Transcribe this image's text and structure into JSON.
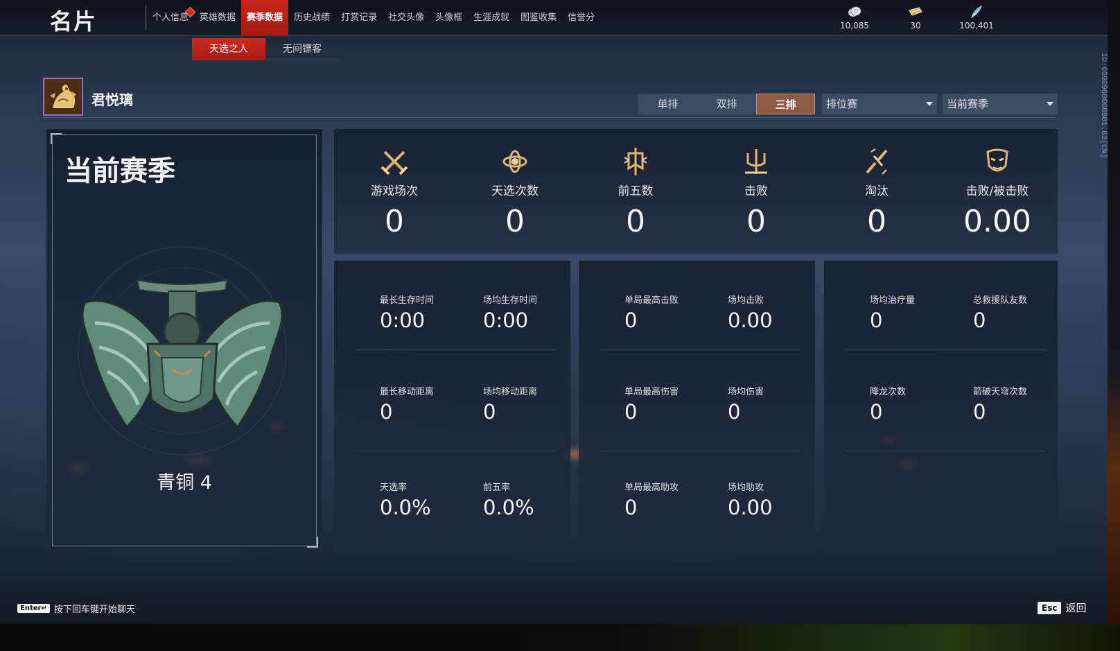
{
  "app_title": "名片",
  "main_tabs": [
    {
      "label": "个人信息",
      "badge": true
    },
    {
      "label": "英雄数据"
    },
    {
      "label": "赛季数据",
      "active": true
    },
    {
      "label": "历史战绩"
    },
    {
      "label": "打赏记录"
    },
    {
      "label": "社交头像"
    },
    {
      "label": "头像框"
    },
    {
      "label": "生涯成就"
    },
    {
      "label": "图鉴收集"
    },
    {
      "label": "信誉分"
    }
  ],
  "currency": [
    {
      "icon": "silver-coin-icon",
      "value": "10,085"
    },
    {
      "icon": "ticket-icon",
      "value": "30"
    },
    {
      "icon": "feather-icon",
      "value": "100,401"
    }
  ],
  "sub_tabs": [
    {
      "label": "天选之人",
      "active": true
    },
    {
      "label": "无间镖客"
    }
  ],
  "player": {
    "name": "君悦璃",
    "id": "ID:6690960000801.63[CN]"
  },
  "filters": {
    "modes": [
      {
        "label": "单排"
      },
      {
        "label": "双排"
      },
      {
        "label": "三排",
        "active": true
      }
    ],
    "match_type": "排位赛",
    "season": "当前赛季"
  },
  "season_panel": {
    "title": "当前赛季",
    "rank": "青铜 4"
  },
  "top_stats": [
    {
      "icon": "crossed-swords-icon",
      "label": "游戏场次",
      "value": "0"
    },
    {
      "icon": "lotus-icon",
      "label": "天选次数",
      "value": "0"
    },
    {
      "icon": "banner-icon",
      "label": "前五数",
      "value": "0"
    },
    {
      "icon": "trident-icon",
      "label": "击败",
      "value": "0"
    },
    {
      "icon": "broken-blade-icon",
      "label": "淘汰",
      "value": "0"
    },
    {
      "icon": "mask-icon",
      "label": "击败/被击败",
      "value": "0.00"
    }
  ],
  "detail_panels": [
    {
      "rows": [
        [
          {
            "label": "最长生存时间",
            "value": "0:00"
          },
          {
            "label": "场均生存时间",
            "value": "0:00"
          }
        ],
        [
          {
            "label": "最长移动距离",
            "value": "0"
          },
          {
            "label": "场均移动距离",
            "value": "0"
          }
        ],
        [
          {
            "label": "天选率",
            "value": "0.0%"
          },
          {
            "label": "前五率",
            "value": "0.0%"
          }
        ]
      ]
    },
    {
      "rows": [
        [
          {
            "label": "单局最高击败",
            "value": "0"
          },
          {
            "label": "场均击败",
            "value": "0.00"
          }
        ],
        [
          {
            "label": "单局最高伤害",
            "value": "0"
          },
          {
            "label": "场均伤害",
            "value": "0"
          }
        ],
        [
          {
            "label": "单局最高助攻",
            "value": "0"
          },
          {
            "label": "场均助攻",
            "value": "0.00"
          }
        ]
      ]
    },
    {
      "rows": [
        [
          {
            "label": "场均治疗量",
            "value": "0"
          },
          {
            "label": "总救援队友数",
            "value": "0"
          }
        ],
        [
          {
            "label": "降龙次数",
            "value": "0"
          },
          {
            "label": "箭破天穹次数",
            "value": "0"
          }
        ]
      ]
    }
  ],
  "footer": {
    "enter_key": "Enter↵",
    "chat_hint": "按下回车键开始聊天",
    "esc_key": "Esc",
    "back_label": "返回"
  },
  "colors": {
    "accent_red": "#c8261d",
    "active_mode": "#8a5a44",
    "avatar_border": "#9c6fc7",
    "icon_gold": "#e0b574"
  }
}
